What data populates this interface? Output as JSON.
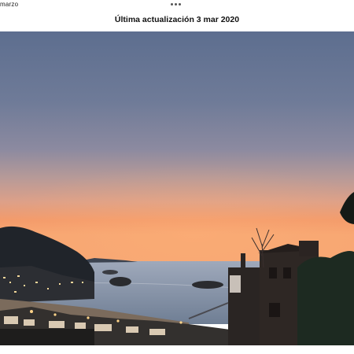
{
  "header": {
    "prev_label": "marzo",
    "title": "Última actualización 3 mar 2020",
    "more_icon": "more-dots-icon"
  },
  "photo": {
    "subject": "coastal-sunset-photo"
  }
}
